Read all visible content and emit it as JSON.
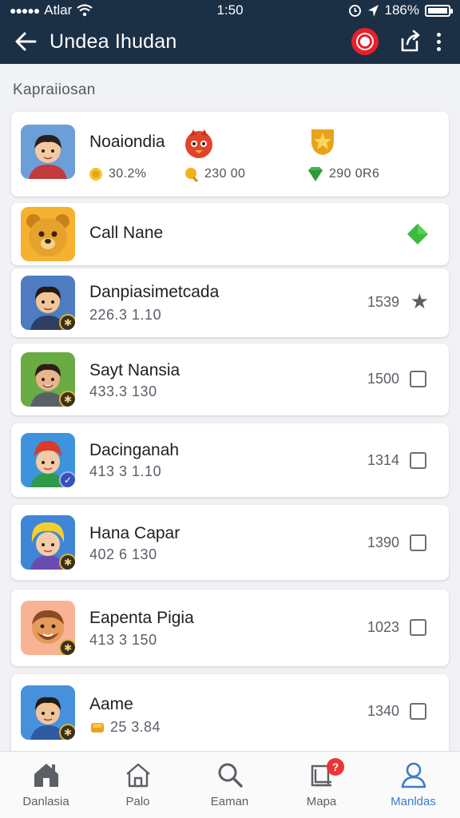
{
  "status": {
    "carrier": "Atlar",
    "time": "1:50",
    "battery": "186%"
  },
  "appbar": {
    "title": "Undea Ihudan"
  },
  "section_title": "Kapraiiosan",
  "top_card": {
    "name": "Noaiondia",
    "stats": [
      {
        "value": "30.2%",
        "icon": "coin-icon"
      },
      {
        "value": "230 00",
        "icon": "medal-icon"
      },
      {
        "value": "290 0R6",
        "icon": "gem-icon"
      }
    ]
  },
  "call_card": {
    "label": "Call Nane"
  },
  "items": [
    {
      "name": "Danpiasimetcada",
      "sub": "226.3 1.10",
      "score": "1539",
      "marker": "star"
    },
    {
      "name": "Sayt Nansia",
      "sub": "433.3 130",
      "score": "1500",
      "marker": "checkbox"
    },
    {
      "name": "Dacinganah",
      "sub": "413 3 1.10",
      "score": "1314",
      "marker": "checkbox"
    },
    {
      "name": "Hana Capar",
      "sub": "402 6 130",
      "score": "1390",
      "marker": "checkbox"
    },
    {
      "name": "Eapenta Pigia",
      "sub": "413 3 150",
      "score": "1023",
      "marker": "checkbox"
    },
    {
      "name": "Aame",
      "sub": "25 3.84",
      "score": "1340",
      "marker": "checkbox"
    }
  ],
  "nav": [
    {
      "label": "Danlasia",
      "icon": "home-filled-icon"
    },
    {
      "label": "Palo",
      "icon": "home-outline-icon"
    },
    {
      "label": "Eaman",
      "icon": "search-icon"
    },
    {
      "label": "Mapa",
      "icon": "bookmark-stack-icon",
      "badge": "?"
    },
    {
      "label": "Manldas",
      "icon": "profile-icon",
      "active": true
    }
  ],
  "colors": {
    "appbar": "#1b2f45",
    "accent": "#3d7cc9",
    "record": "#e8202a",
    "check": "#3cba3c"
  }
}
